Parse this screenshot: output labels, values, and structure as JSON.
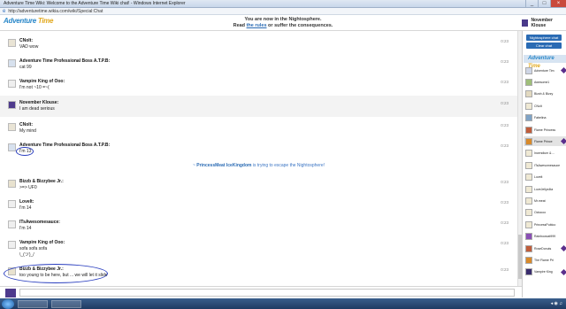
{
  "window": {
    "title": "Adventure Time Wiki: Welcome to the Adventure Time Wiki chat! - Windows Internet Explorer",
    "url": "http://adventuretime.wikia.com/wiki/Special:Chat"
  },
  "header": {
    "logo": {
      "part1": "Adventure",
      "part2": "Time"
    },
    "notice_line1": "You are now in the Nightosphere.",
    "notice_line2_before": "Read ",
    "notice_link": "the rules",
    "notice_line2_after": " or suffer the consequences.",
    "current_user": "November Klouse"
  },
  "messages": [
    {
      "user": "CNolt:",
      "text": "VAD wow",
      "time": "0:23",
      "avatar": "av-a"
    },
    {
      "user": "Adventure Time Professional Boss A.T.P.B:",
      "text": "cat 99",
      "time": "0:23",
      "avatar": "av-b"
    },
    {
      "user": "Vampire King of Ooo:",
      "text": "I'm not ~10 =~(",
      "time": "0:23",
      "avatar": "av-c"
    },
    {
      "user": "November Klouse:",
      "text": "I am dead serious",
      "time": "0:23",
      "avatar": "av-d"
    },
    {
      "user": "CNolt:",
      "text": "My mind",
      "time": "0:23",
      "avatar": "av-a"
    },
    {
      "user": "Adventure Time Professional Boss A.T.P.B:",
      "text": "I'm 13",
      "time": "0:23",
      "avatar": "av-b"
    },
    {
      "user": "Bizzb & Bizzybee Jr.:",
      "text": ">=> UF0",
      "time": "0:23",
      "avatar": "av-e"
    },
    {
      "user": "Lovelt:",
      "text": "I'm 14",
      "time": "0:23",
      "avatar": "av-c"
    },
    {
      "user": "ITsAwesomesauce:",
      "text": "I'm 14",
      "time": "0:23",
      "avatar": "av-c"
    },
    {
      "user": "Vampire King of Ooo:",
      "text": "sofa sofa sofa",
      "text2": "\\_(ツ)_/",
      "time": "0:23",
      "avatar": "av-c"
    },
    {
      "user": "Bizzb & Bizzybee Jr.:",
      "text": "too young to be here, but ... we will let it slide",
      "time": "0:23",
      "avatar": "av-e"
    }
  ],
  "inline_alert": {
    "user": "PrincessMeat IceKingdom",
    "text": " is trying to escape the Nightosphere!"
  },
  "sidebar": {
    "room_button": "Nightosphere chat",
    "clear_button": "Clear chat",
    "logo": {
      "part1": "Adventure",
      "part2": "Time"
    },
    "users": [
      {
        "name": "Adventure Tim",
        "badge": true,
        "avatar": "u1"
      },
      {
        "name": "Awesome1",
        "badge": false,
        "avatar": "u2"
      },
      {
        "name": "Bizzb & Bizzy",
        "badge": false,
        "avatar": "u4"
      },
      {
        "name": "CNolt",
        "badge": false,
        "avatar": "u9"
      },
      {
        "name": "Fabelina",
        "badge": false,
        "avatar": "u8"
      },
      {
        "name": "Flame Princess",
        "badge": false,
        "avatar": "u3"
      },
      {
        "name": "Flame Prince",
        "badge": true,
        "avatar": "u6"
      },
      {
        "name": "Incendium & ...",
        "badge": false,
        "avatar": "u9"
      },
      {
        "name": "ITsAwesomesauce",
        "badge": false,
        "avatar": "u9"
      },
      {
        "name": "Lovelt",
        "badge": false,
        "avatar": "u9"
      },
      {
        "name": "LoveJellyz4ta",
        "badge": false,
        "avatar": "u9"
      },
      {
        "name": "Mr.meat",
        "badge": false,
        "avatar": "u9"
      },
      {
        "name": "Octocoo",
        "badge": false,
        "avatar": "u9"
      },
      {
        "name": "PrincessPubloo",
        "badge": false,
        "avatar": "u9"
      },
      {
        "name": "Rainbowcat999",
        "badge": false,
        "avatar": "u7"
      },
      {
        "name": "RoseDonuts",
        "badge": true,
        "avatar": "u3"
      },
      {
        "name": "The Flame Pri",
        "badge": false,
        "avatar": "u6"
      },
      {
        "name": "Vampire King",
        "badge": true,
        "avatar": "u5"
      }
    ]
  },
  "colors": {
    "accent": "#2a6bb4",
    "annotation_circle": "#2b3fbf",
    "badge": "#5b2f8c"
  }
}
